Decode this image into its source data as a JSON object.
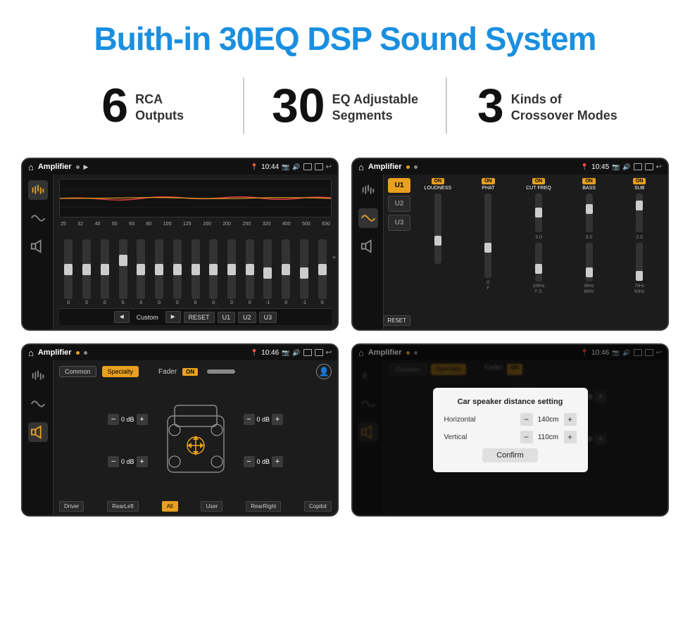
{
  "header": {
    "title": "Buith-in 30EQ DSP Sound System"
  },
  "stats": [
    {
      "number": "6",
      "label_line1": "RCA",
      "label_line2": "Outputs"
    },
    {
      "number": "30",
      "label_line1": "EQ Adjustable",
      "label_line2": "Segments"
    },
    {
      "number": "3",
      "label_line1": "Kinds of",
      "label_line2": "Crossover Modes"
    }
  ],
  "screens": [
    {
      "id": "eq-screen",
      "status_bar": {
        "app": "Amplifier",
        "time": "10:44"
      },
      "type": "eq"
    },
    {
      "id": "dsp-screen",
      "status_bar": {
        "app": "Amplifier",
        "time": "10:45"
      },
      "type": "dsp"
    },
    {
      "id": "fader-screen",
      "status_bar": {
        "app": "Amplifier",
        "time": "10:46"
      },
      "type": "fader"
    },
    {
      "id": "distance-screen",
      "status_bar": {
        "app": "Amplifier",
        "time": "10:46"
      },
      "type": "distance"
    }
  ],
  "eq": {
    "freq_labels": [
      "25",
      "32",
      "40",
      "50",
      "63",
      "80",
      "100",
      "125",
      "160",
      "200",
      "250",
      "320",
      "400",
      "500",
      "630"
    ],
    "sliders": [
      {
        "pos": 50,
        "val": "0"
      },
      {
        "pos": 50,
        "val": "0"
      },
      {
        "pos": 50,
        "val": "0"
      },
      {
        "pos": 40,
        "val": "5"
      },
      {
        "pos": 50,
        "val": "0"
      },
      {
        "pos": 50,
        "val": "0"
      },
      {
        "pos": 50,
        "val": "0"
      },
      {
        "pos": 50,
        "val": "0"
      },
      {
        "pos": 50,
        "val": "0"
      },
      {
        "pos": 50,
        "val": "0"
      },
      {
        "pos": 50,
        "val": "0"
      },
      {
        "pos": 55,
        "val": "-1"
      },
      {
        "pos": 50,
        "val": "0"
      },
      {
        "pos": 55,
        "val": "-1"
      },
      {
        "pos": 50,
        "val": "0"
      }
    ],
    "bottom_buttons": [
      "Custom",
      "RESET",
      "U1",
      "U2",
      "U3"
    ]
  },
  "dsp": {
    "presets": [
      "U1",
      "U2",
      "U3"
    ],
    "channels": [
      {
        "name": "LOUDNESS",
        "on": true
      },
      {
        "name": "PHAT",
        "on": true
      },
      {
        "name": "CUT FREQ",
        "on": true
      },
      {
        "name": "BASS",
        "on": true
      },
      {
        "name": "SUB",
        "on": true
      }
    ],
    "reset_label": "RESET"
  },
  "fader": {
    "tabs": [
      "Common",
      "Specialty"
    ],
    "label": "Fader",
    "on_label": "ON",
    "volumes": [
      "0 dB",
      "0 dB",
      "0 dB",
      "0 dB"
    ],
    "bottom_btns": [
      "Driver",
      "RearLeft",
      "All",
      "User",
      "RearRight",
      "Copilot"
    ]
  },
  "distance_dialog": {
    "title": "Car speaker distance setting",
    "horizontal_label": "Horizontal",
    "horizontal_value": "140cm",
    "vertical_label": "Vertical",
    "vertical_value": "110cm",
    "confirm_label": "Confirm"
  }
}
